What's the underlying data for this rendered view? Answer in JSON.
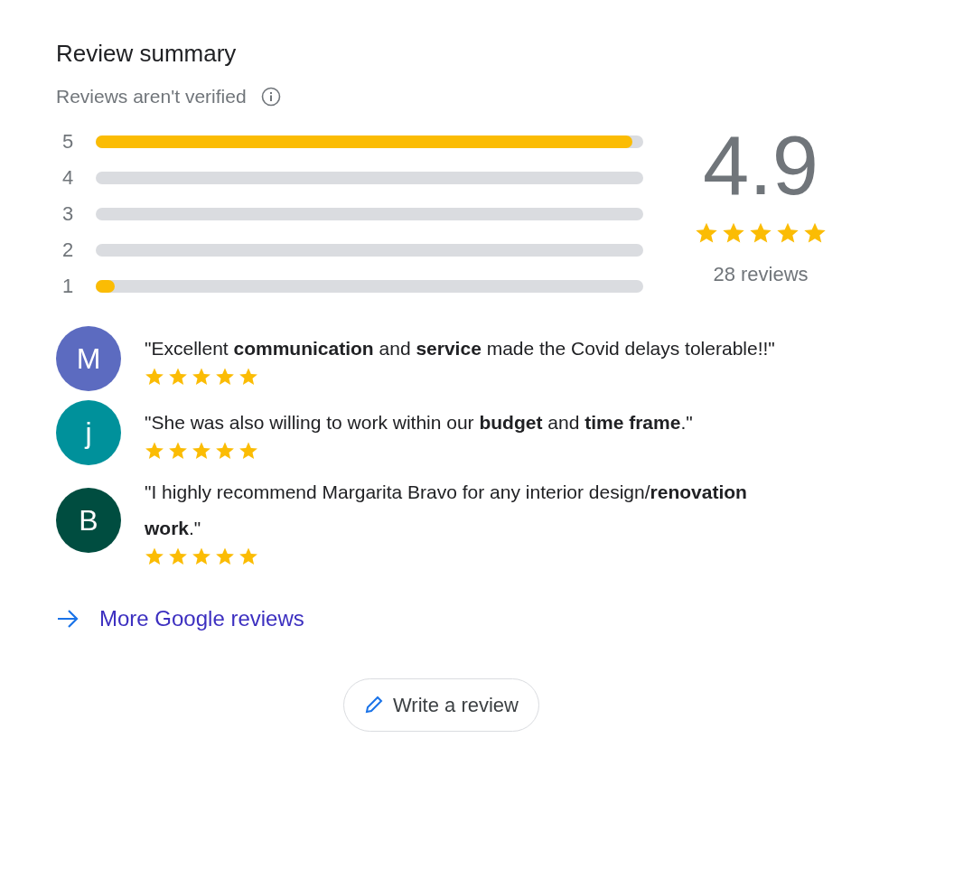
{
  "title": "Review summary",
  "notice": {
    "text": "Reviews aren't verified"
  },
  "distribution": [
    {
      "label": "5",
      "level": 0.98
    },
    {
      "label": "4"
    },
    {
      "label": "3"
    },
    {
      "label": "2"
    },
    {
      "label": "1",
      "level": 0.035
    }
  ],
  "overall": {
    "rating": "4.9",
    "stars": 5,
    "count": "28 reviews"
  },
  "reviews": [
    {
      "initial": "M",
      "color": "#5c6bc0",
      "text": "\"Excellent **communication** and **service** made the Covid delays tolerable!!\"",
      "stars": 5
    },
    {
      "initial": "j",
      "color": "#00919b",
      "text": "\"She was also willing to work within our **budget** and **time frame**.\"",
      "stars": 5
    },
    {
      "initial": "B",
      "color": "#004d40",
      "text": "\"I highly recommend Margarita Bravo for any interior design/**renovation work**.\"",
      "stars": 5
    }
  ],
  "more_link": "More Google reviews",
  "write_button": "Write a review"
}
